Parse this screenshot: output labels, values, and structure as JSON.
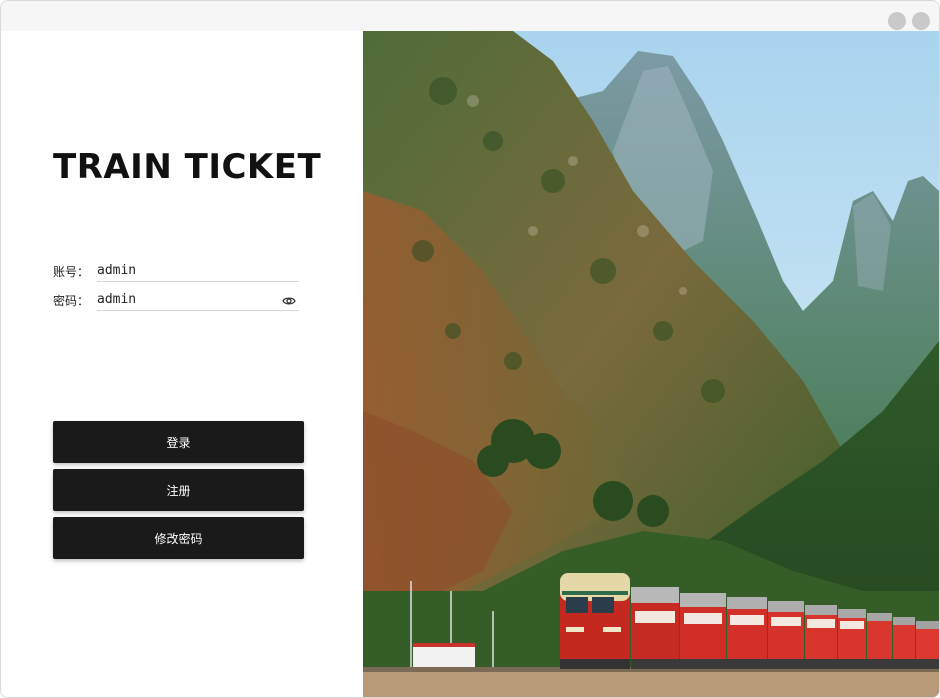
{
  "app": {
    "title": "TRAIN TICKET"
  },
  "form": {
    "account_label": "账号：",
    "account_value": "admin",
    "password_label": "密码：",
    "password_value": "admin"
  },
  "buttons": {
    "login": "登录",
    "register": "注册",
    "change_password": "修改密码"
  },
  "icons": {
    "password_toggle": "eye-icon",
    "window_minimize": "circle-button",
    "window_close": "circle-button"
  },
  "colors": {
    "button_background": "#1a1a1a",
    "button_text": "#ffffff",
    "title_text": "#111111",
    "sky": "#cfe6f5",
    "train_red": "#d42a24"
  }
}
